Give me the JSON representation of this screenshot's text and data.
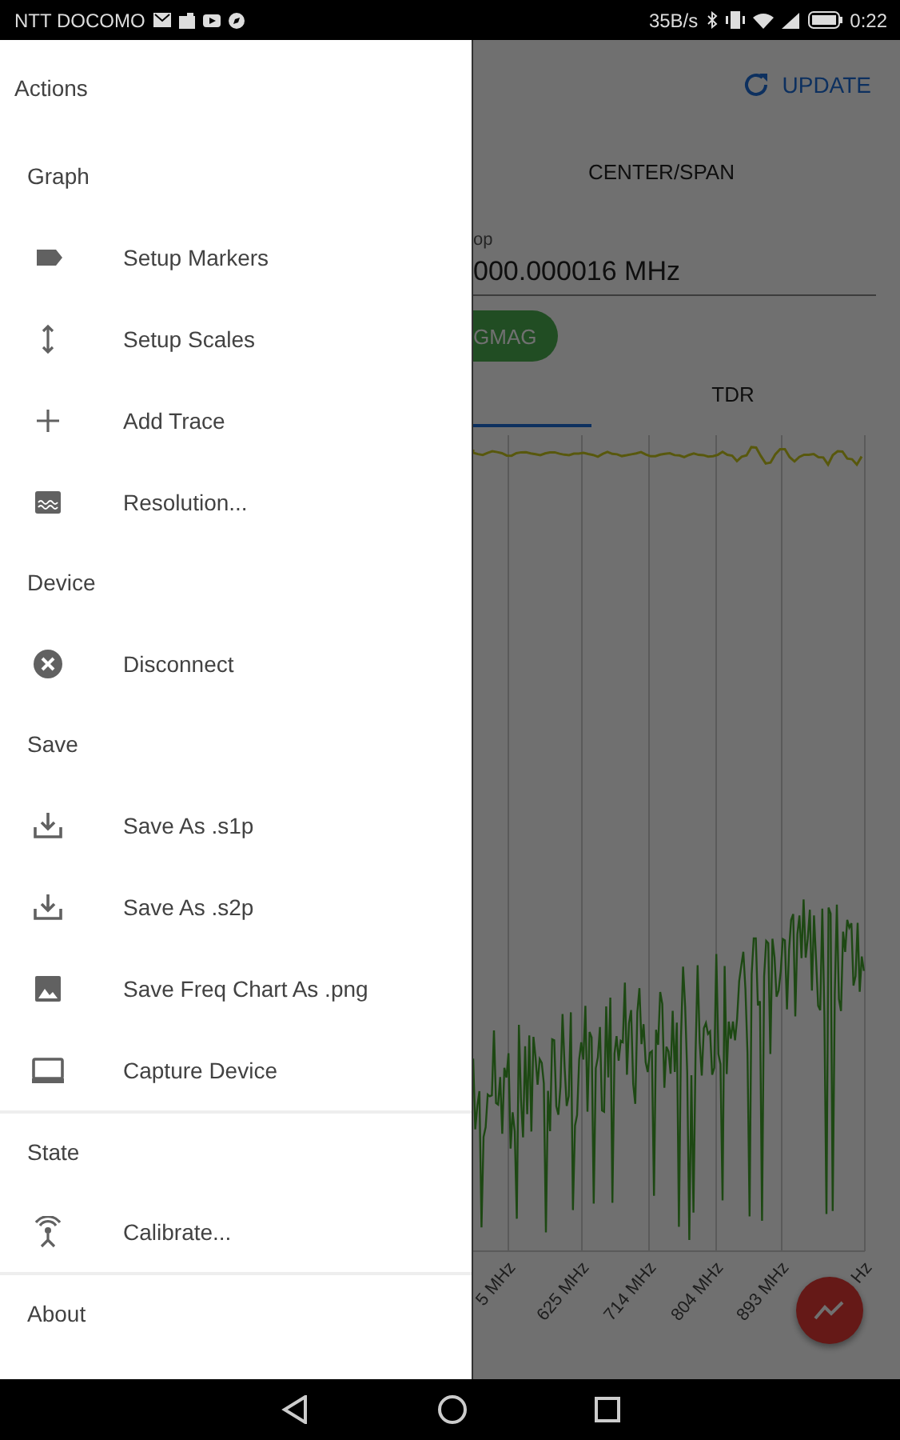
{
  "status_bar": {
    "carrier": "NTT DOCOMO",
    "speed": "35B/s",
    "time": "0:22"
  },
  "drawer": {
    "title": "Actions",
    "sections": [
      {
        "header": "Graph",
        "divider": false,
        "items": [
          {
            "label": "Setup Markers",
            "kind": "marker"
          },
          {
            "label": "Setup Scales",
            "kind": "scales"
          },
          {
            "label": "Add Trace",
            "kind": "add"
          },
          {
            "label": "Resolution...",
            "kind": "resolution"
          }
        ]
      },
      {
        "header": "Device",
        "divider": false,
        "items": [
          {
            "label": "Disconnect",
            "kind": "disconnect"
          }
        ]
      },
      {
        "header": "Save",
        "divider": false,
        "items": [
          {
            "label": "Save As .s1p",
            "kind": "download"
          },
          {
            "label": "Save As .s2p",
            "kind": "download"
          },
          {
            "label": "Save Freq Chart As .png",
            "kind": "image"
          },
          {
            "label": "Capture Device",
            "kind": "laptop"
          }
        ]
      },
      {
        "header": "State",
        "divider": true,
        "items": [
          {
            "label": "Calibrate...",
            "kind": "antenna"
          }
        ]
      },
      {
        "header": "About",
        "divider": true
      }
    ]
  },
  "app": {
    "action": "UPDATE",
    "mode_tab": "CENTER/SPAN",
    "field": {
      "label": "op",
      "value": "000.000016 MHz"
    },
    "chip": "GMAG",
    "tabs": [
      {
        "selected": true
      },
      {
        "label": "TDR",
        "selected": false
      }
    ],
    "x_labels": [
      "5 MHz",
      "625 MHz",
      "714 MHz",
      "804 MHz",
      "893 MHz",
      "Hz"
    ]
  }
}
